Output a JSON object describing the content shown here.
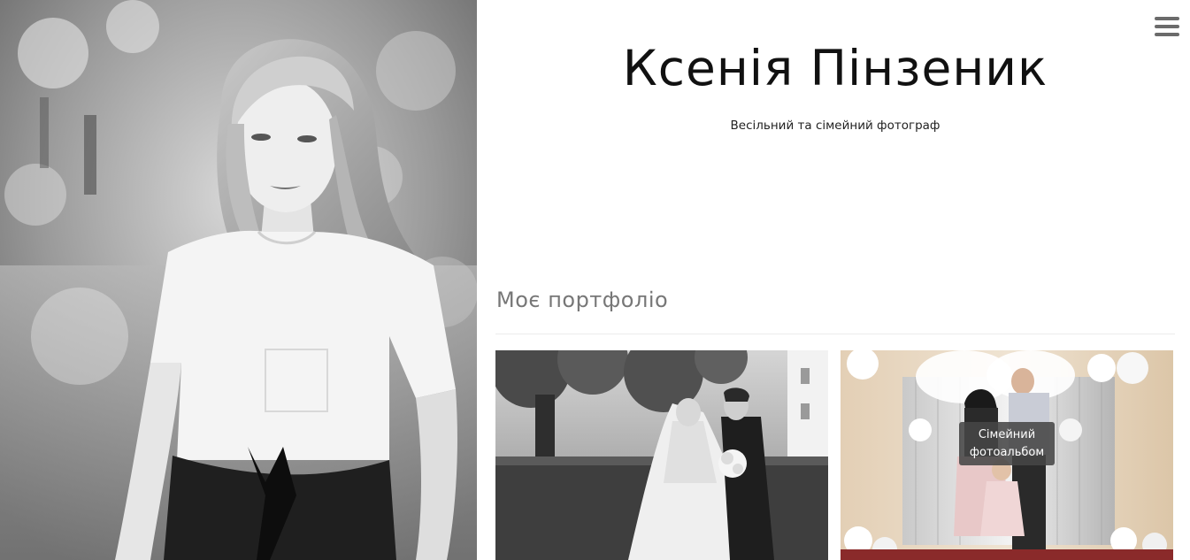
{
  "header": {
    "title": "Ксенія Пінзеник",
    "tagline": "Весільний та сімейний фотограф"
  },
  "hero": {
    "image": "portrait-photo",
    "style": "black-and-white"
  },
  "menu": {
    "icon": "hamburger-menu-icon"
  },
  "portfolio": {
    "heading": "Моє портфоліо",
    "items": [
      {
        "image": "wedding-couple-photo",
        "caption": ""
      },
      {
        "image": "family-album-photo",
        "caption": "Сімейний фотоальбом"
      }
    ]
  },
  "colors": {
    "title": "#111111",
    "heading": "#777777",
    "menu_icon": "#6b6b6b",
    "caption_bg": "#464646"
  }
}
